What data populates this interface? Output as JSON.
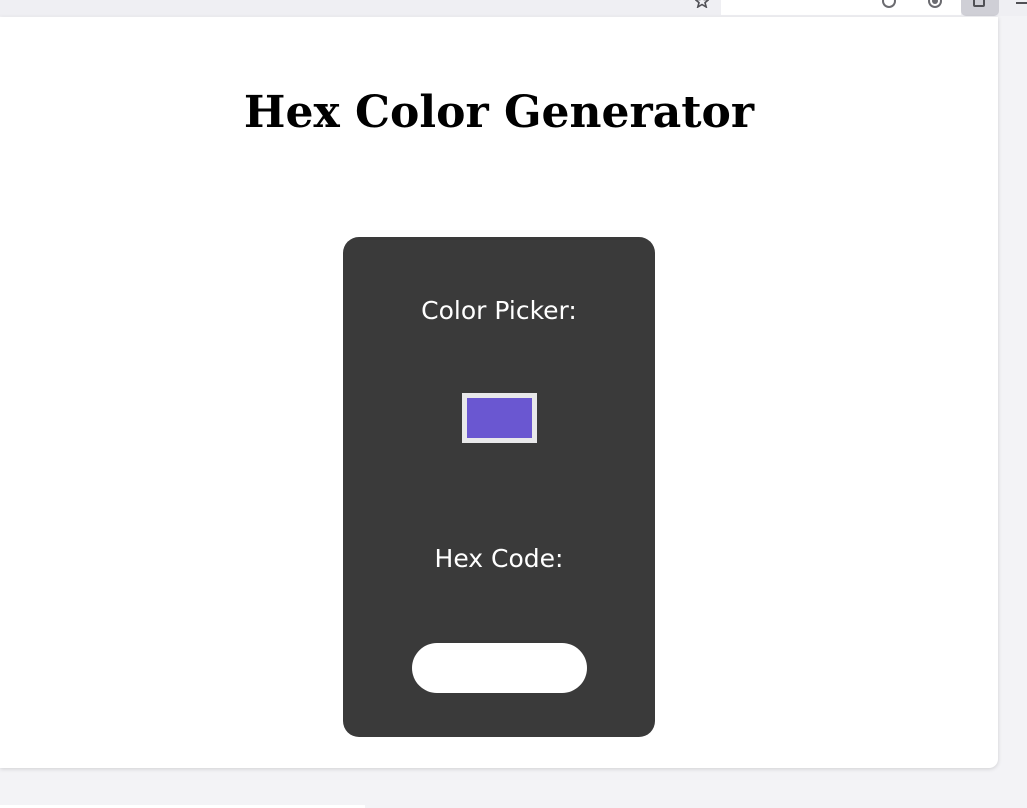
{
  "app": {
    "title": "Hex Color Generator"
  },
  "card": {
    "picker_label": "Color Picker:",
    "hex_label": "Hex Code:",
    "hex_value": "",
    "selected_color": "#6a57d1",
    "card_color": "#3a3a3a"
  },
  "icons": [
    "bookmark-star-icon",
    "sync-icon",
    "account-icon",
    "extensions-icon",
    "menu-icon"
  ]
}
